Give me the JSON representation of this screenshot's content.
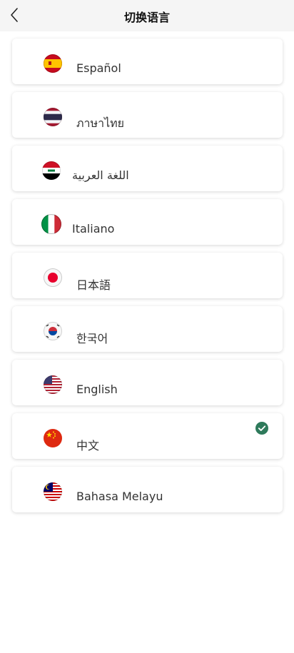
{
  "header": {
    "title": "切换语言",
    "back_icon": "chevron-left-icon"
  },
  "languages": [
    {
      "label": "Español",
      "flag": "spain-flag-icon",
      "selected": false
    },
    {
      "label": "ภาษาไทย",
      "flag": "thailand-flag-icon",
      "selected": false
    },
    {
      "label": "اللغة العربية",
      "flag": "iraq-flag-icon",
      "selected": false
    },
    {
      "label": "Italiano",
      "flag": "italy-flag-icon",
      "selected": false
    },
    {
      "label": "日本語",
      "flag": "japan-flag-icon",
      "selected": false
    },
    {
      "label": "한국어",
      "flag": "south-korea-flag-icon",
      "selected": false
    },
    {
      "label": "English",
      "flag": "usa-flag-icon",
      "selected": false
    },
    {
      "label": "中文",
      "flag": "china-flag-icon",
      "selected": true
    },
    {
      "label": "Bahasa Melayu",
      "flag": "malaysia-flag-icon",
      "selected": false
    }
  ],
  "colors": {
    "header_bg": "#f5f5f5",
    "check_green": "#2e7a5b"
  }
}
